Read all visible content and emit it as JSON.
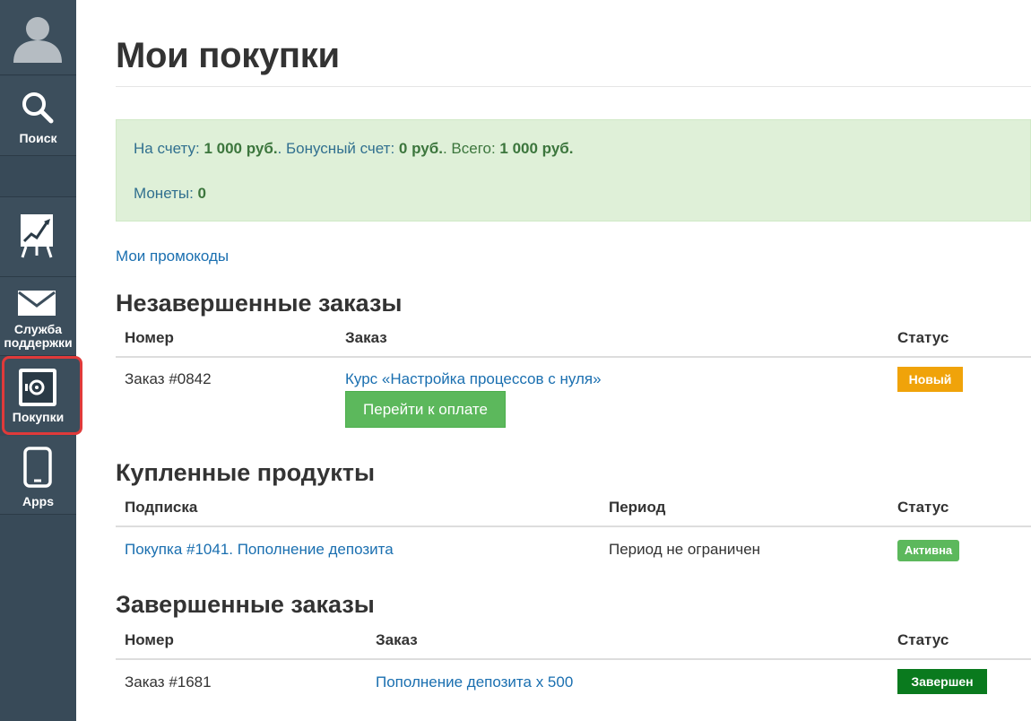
{
  "sidebar": {
    "items": [
      {
        "label": "Поиск",
        "icon": "search-icon"
      },
      {
        "label": "",
        "icon": "chart-icon"
      },
      {
        "label": "Служба поддержки",
        "icon": "mail-icon"
      },
      {
        "label": "Покупки",
        "icon": "safe-icon"
      },
      {
        "label": "Apps",
        "icon": "phone-icon"
      }
    ]
  },
  "page": {
    "title": "Мои покупки"
  },
  "balance": {
    "account_label": "На счету: ",
    "account_value": "1 000 руб.",
    "bonus_label": ". Бонусный счет: ",
    "bonus_value": "0 руб.",
    "total_label": ". Всего: ",
    "total_value": "1 000 руб.",
    "coins_label": "Монеты: ",
    "coins_value": "0"
  },
  "promo_link": "Мои промокоды",
  "incomplete": {
    "title": "Незавершенные заказы",
    "headers": [
      "Номер",
      "Заказ",
      "Статус"
    ],
    "rows": [
      {
        "number": "Заказ #0842",
        "order": "Курс «Настройка процессов с нуля»",
        "button": "Перейти к оплате",
        "status": "Новый"
      }
    ]
  },
  "purchased": {
    "title": "Купленные продукты",
    "headers": [
      "Подписка",
      "Период",
      "Статус"
    ],
    "rows": [
      {
        "subscription": "Покупка #1041. Пополнение депозита",
        "period": "Период не ограничен",
        "status": "Активна"
      }
    ]
  },
  "completed": {
    "title": "Завершенные заказы",
    "headers": [
      "Номер",
      "Заказ",
      "Статус"
    ],
    "rows": [
      {
        "number": "Заказ #1681",
        "order": "Пополнение депозита x 500",
        "status": "Завершен"
      }
    ]
  },
  "colors": {
    "sidebar": "#384a58",
    "highlight": "#e03a3a",
    "alert_bg": "#dff0d8",
    "link": "#1a6fb0",
    "btn_green": "#5cb85c",
    "badge_new": "#f0a30a",
    "badge_done": "#0a7a1e"
  }
}
